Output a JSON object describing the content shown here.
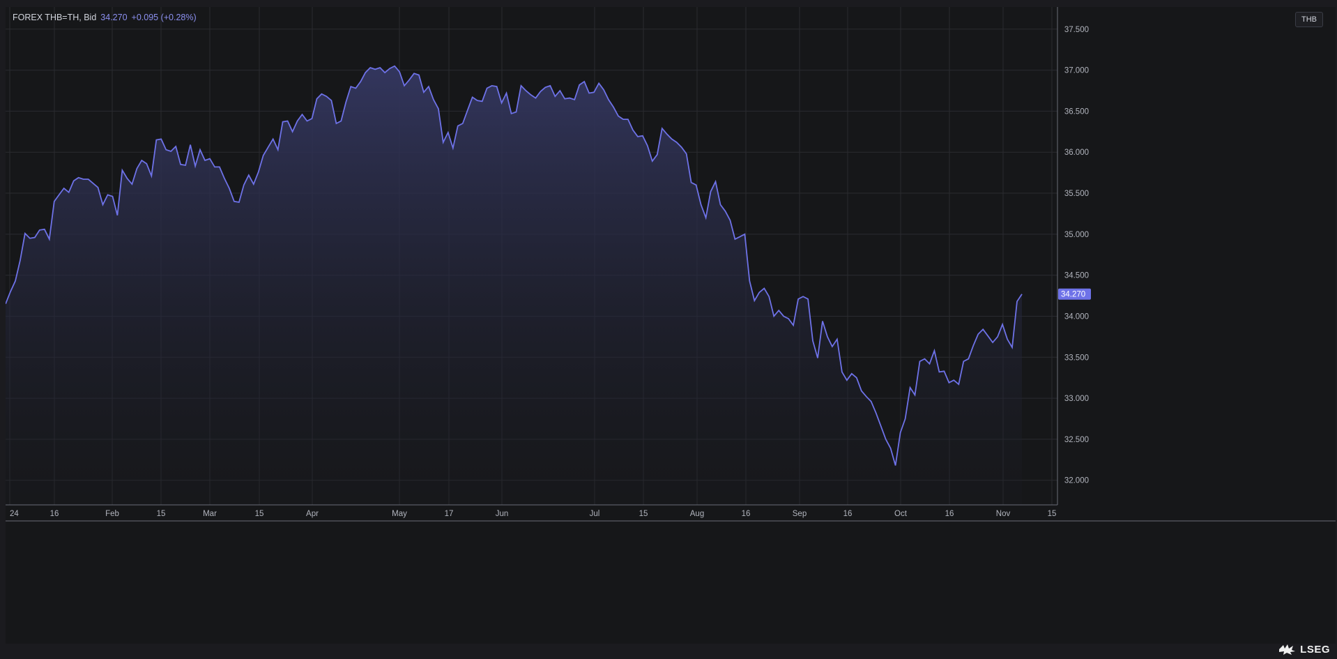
{
  "legend": {
    "symbol": "FOREX THB=TH, Bid",
    "last": "34.270",
    "change": "+0.095 (+0.28%)"
  },
  "unit_badge": "THB",
  "brand": "LSEG",
  "colors": {
    "line": "#6e72e8",
    "fill_top": "#33365e",
    "price_tag": "#6e72e8",
    "grid": "#2a2b30",
    "background": "#161719"
  },
  "chart_data": {
    "type": "area",
    "series_label": "Bid",
    "y_ticks": [
      "32.000",
      "32.500",
      "33.000",
      "33.500",
      "34.000",
      "34.500",
      "35.000",
      "35.500",
      "36.000",
      "36.500",
      "37.000",
      "37.500"
    ],
    "ylim": [
      31.7,
      37.77
    ],
    "x_ticks": [
      "24",
      "16",
      "Feb",
      "15",
      "Mar",
      "15",
      "Apr",
      "May",
      "17",
      "Jun",
      "Jul",
      "15",
      "Aug",
      "16",
      "Sep",
      "16",
      "Oct",
      "16",
      "Nov",
      "15"
    ],
    "last_value_label": "34.270",
    "values": [
      34.15,
      34.3,
      34.43,
      34.68,
      35.01,
      34.95,
      34.96,
      35.05,
      35.06,
      34.94,
      35.4,
      35.48,
      35.56,
      35.51,
      35.65,
      35.69,
      35.67,
      35.67,
      35.62,
      35.57,
      35.36,
      35.48,
      35.46,
      35.23,
      35.78,
      35.68,
      35.61,
      35.8,
      35.9,
      35.86,
      35.71,
      36.15,
      36.16,
      36.03,
      36.01,
      36.07,
      35.85,
      35.84,
      36.09,
      35.83,
      36.03,
      35.9,
      35.92,
      35.82,
      35.82,
      35.68,
      35.56,
      35.4,
      35.39,
      35.6,
      35.72,
      35.61,
      35.76,
      35.96,
      36.06,
      36.16,
      36.03,
      36.37,
      36.38,
      36.25,
      36.38,
      36.46,
      36.38,
      36.41,
      36.65,
      36.71,
      36.68,
      36.63,
      36.35,
      36.38,
      36.61,
      36.8,
      36.78,
      36.86,
      36.97,
      37.03,
      37.01,
      37.03,
      36.97,
      37.02,
      37.05,
      36.98,
      36.81,
      36.88,
      36.96,
      36.94,
      36.73,
      36.8,
      36.64,
      36.53,
      36.12,
      36.24,
      36.05,
      36.32,
      36.35,
      36.51,
      36.67,
      36.63,
      36.62,
      36.78,
      36.81,
      36.8,
      36.6,
      36.72,
      36.47,
      36.49,
      36.81,
      36.75,
      36.7,
      36.66,
      36.74,
      36.79,
      36.81,
      36.68,
      36.75,
      36.65,
      36.66,
      36.64,
      36.82,
      36.86,
      36.72,
      36.73,
      36.84,
      36.76,
      36.64,
      36.55,
      36.44,
      36.4,
      36.4,
      36.27,
      36.19,
      36.2,
      36.08,
      35.89,
      35.97,
      36.29,
      36.22,
      36.16,
      36.12,
      36.06,
      35.98,
      35.63,
      35.6,
      35.36,
      35.2,
      35.52,
      35.64,
      35.36,
      35.28,
      35.17,
      34.94,
      34.97,
      35.0,
      34.43,
      34.19,
      34.29,
      34.34,
      34.24,
      34.0,
      34.07,
      34.0,
      33.97,
      33.89,
      34.21,
      34.24,
      34.21,
      33.7,
      33.49,
      33.94,
      33.75,
      33.63,
      33.72,
      33.32,
      33.22,
      33.3,
      33.25,
      33.09,
      33.02,
      32.96,
      32.82,
      32.66,
      32.5,
      32.39,
      32.18,
      32.58,
      32.75,
      33.13,
      33.04,
      33.45,
      33.48,
      33.42,
      33.58,
      33.32,
      33.33,
      33.19,
      33.22,
      33.17,
      33.45,
      33.48,
      33.64,
      33.78,
      33.84,
      33.76,
      33.68,
      33.75,
      33.9,
      33.72,
      33.62,
      34.18,
      34.27
    ]
  }
}
